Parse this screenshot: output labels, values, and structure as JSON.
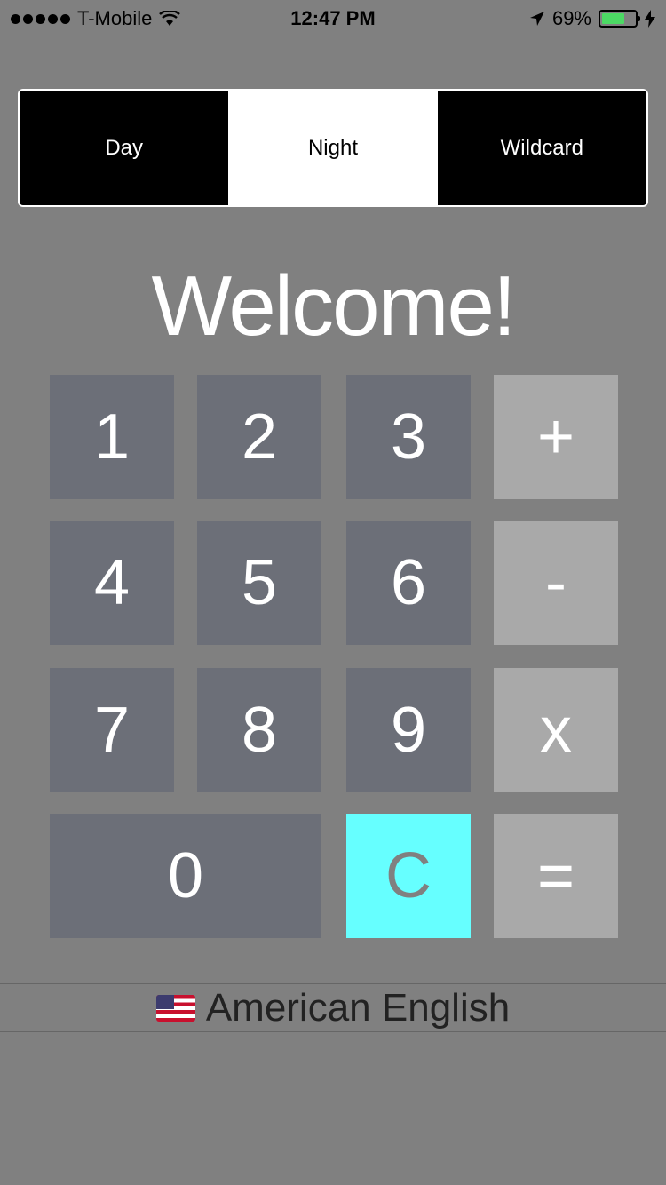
{
  "status_bar": {
    "carrier": "T-Mobile",
    "time": "12:47 PM",
    "battery": "69%",
    "battery_level": 0.69,
    "icons": [
      "signal-dots-icon",
      "wifi-icon",
      "location-arrow-icon",
      "battery-icon",
      "charging-bolt-icon"
    ]
  },
  "segments": {
    "items": [
      "Day",
      "Night",
      "Wildcard"
    ],
    "selected": "Night"
  },
  "welcome": "Welcome!",
  "keypad": {
    "row1": [
      "1",
      "2",
      "3",
      "+"
    ],
    "row2": [
      "4",
      "5",
      "6",
      "-"
    ],
    "row3": [
      "7",
      "8",
      "9",
      "x"
    ],
    "row4": [
      "0",
      "C",
      "="
    ]
  },
  "colors": {
    "background": "#808080",
    "digit_key": "#6c6f78",
    "operator_key": "#a9a9a9",
    "clear_key": "#66ffff"
  },
  "language": {
    "label": "American English",
    "flag": "us-flag-icon"
  }
}
